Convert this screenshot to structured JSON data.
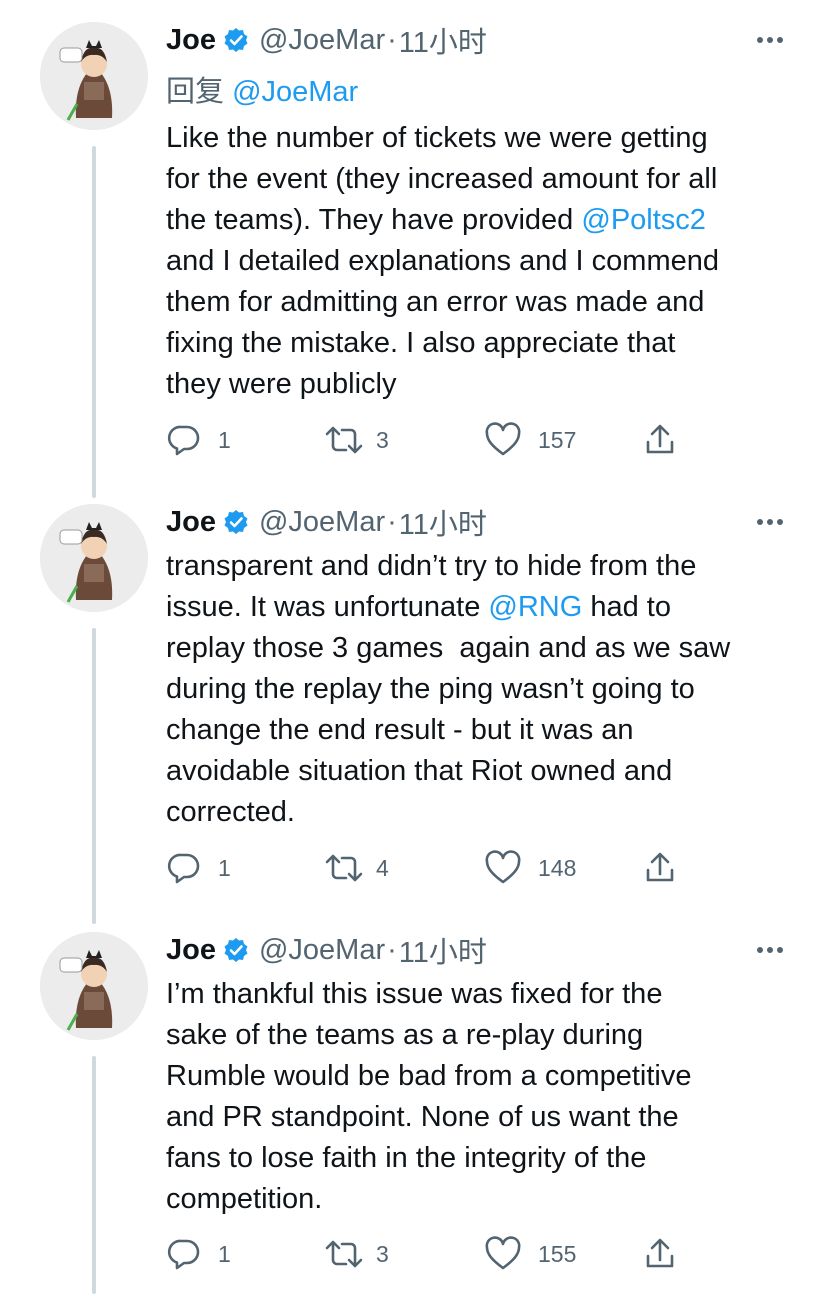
{
  "tweets": [
    {
      "name": "Joe",
      "handle": "@JoeMar",
      "dot": "·",
      "time": "11小时",
      "reply_prefix": "回复",
      "reply_handle": "@JoeMar",
      "lines": [
        [
          {
            "t": "Like the number of tickets we were getting"
          }
        ],
        [
          {
            "t": "for the event (they increased amount for all"
          }
        ],
        [
          {
            "t": "the teams). They have provided "
          },
          {
            "t": "@Poltsc2",
            "m": true
          }
        ],
        [
          {
            "t": "and I detailed explanations and I commend"
          }
        ],
        [
          {
            "t": "them for admitting an error was made and"
          }
        ],
        [
          {
            "t": "fixing the mistake. I also appreciate that"
          }
        ],
        [
          {
            "t": "they were publicly"
          }
        ]
      ],
      "replies": "1",
      "retweets": "3",
      "likes": "157"
    },
    {
      "name": "Joe",
      "handle": "@JoeMar",
      "dot": "·",
      "time": "11小时",
      "lines": [
        [
          {
            "t": "transparent and didn’t try to hide from the"
          }
        ],
        [
          {
            "t": "issue. It was unfortunate "
          },
          {
            "t": "@RNG",
            "m": true
          },
          {
            "t": " had to"
          }
        ],
        [
          {
            "t": "replay those 3 games  again and as we saw"
          }
        ],
        [
          {
            "t": "during the replay the ping wasn’t going to"
          }
        ],
        [
          {
            "t": "change the end result - but it was an"
          }
        ],
        [
          {
            "t": "avoidable situation that Riot owned and"
          }
        ],
        [
          {
            "t": "corrected."
          }
        ]
      ],
      "replies": "1",
      "retweets": "4",
      "likes": "148"
    },
    {
      "name": "Joe",
      "handle": "@JoeMar",
      "dot": "·",
      "time": "11小时",
      "lines": [
        [
          {
            "t": "I’m thankful this issue was fixed for the"
          }
        ],
        [
          {
            "t": "sake of the teams as a re-play during"
          }
        ],
        [
          {
            "t": "Rumble would be bad from a competitive"
          }
        ],
        [
          {
            "t": "and PR standpoint. None of us want the"
          }
        ],
        [
          {
            "t": "fans to lose faith in the integrity of the"
          }
        ],
        [
          {
            "t": "competition."
          }
        ]
      ],
      "replies": "1",
      "retweets": "3",
      "likes": "155"
    }
  ],
  "icons": {
    "verified": "verified-badge-icon",
    "more": "more-options-icon",
    "reply": "reply-icon",
    "retweet": "retweet-icon",
    "like": "like-icon",
    "share": "share-icon"
  },
  "colors": {
    "link": "#1d9bf0",
    "text": "#0f1419",
    "secondary": "#536471",
    "thread_line": "#cfd9de"
  }
}
